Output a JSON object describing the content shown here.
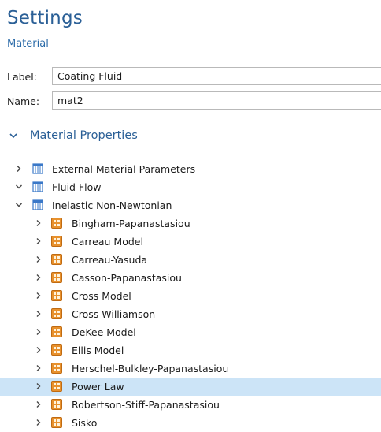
{
  "header": {
    "title": "Settings",
    "subtitle": "Material"
  },
  "fields": {
    "label_caption": "Label:",
    "label_value": "Coating Fluid",
    "name_caption": "Name:",
    "name_value": "mat2"
  },
  "section": {
    "title": "Material Properties",
    "expanded": true
  },
  "tree": {
    "items": [
      {
        "label": "External Material Parameters",
        "level": 0,
        "expanded": false,
        "icon": "table-icon"
      },
      {
        "label": "Fluid Flow",
        "level": 0,
        "expanded": true,
        "icon": "table-icon"
      },
      {
        "label": "Inelastic Non-Newtonian",
        "level": 1,
        "expanded": true,
        "icon": "table-icon"
      },
      {
        "label": "Bingham-Papanastasiou",
        "level": 2,
        "expanded": false,
        "icon": "property-group-icon"
      },
      {
        "label": "Carreau Model",
        "level": 2,
        "expanded": false,
        "icon": "property-group-icon"
      },
      {
        "label": "Carreau-Yasuda",
        "level": 2,
        "expanded": false,
        "icon": "property-group-icon"
      },
      {
        "label": "Casson-Papanastasiou",
        "level": 2,
        "expanded": false,
        "icon": "property-group-icon"
      },
      {
        "label": "Cross Model",
        "level": 2,
        "expanded": false,
        "icon": "property-group-icon"
      },
      {
        "label": "Cross-Williamson",
        "level": 2,
        "expanded": false,
        "icon": "property-group-icon"
      },
      {
        "label": "DeKee Model",
        "level": 2,
        "expanded": false,
        "icon": "property-group-icon"
      },
      {
        "label": "Ellis Model",
        "level": 2,
        "expanded": false,
        "icon": "property-group-icon"
      },
      {
        "label": "Herschel-Bulkley-Papanastasiou",
        "level": 2,
        "expanded": false,
        "icon": "property-group-icon"
      },
      {
        "label": "Power Law",
        "level": 2,
        "expanded": false,
        "icon": "property-group-icon",
        "selected": true
      },
      {
        "label": "Robertson-Stiff-Papanastasiou",
        "level": 2,
        "expanded": false,
        "icon": "property-group-icon"
      },
      {
        "label": "Sisko",
        "level": 2,
        "expanded": false,
        "icon": "property-group-icon"
      }
    ]
  },
  "colors": {
    "accent": "#2a5f96",
    "selection": "#cce4f7",
    "group_icon": "#e8912d",
    "table_icon": "#3a78c8"
  }
}
